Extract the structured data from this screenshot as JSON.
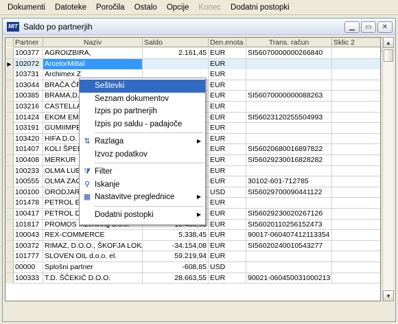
{
  "menubar": {
    "items": [
      "Dokumenti",
      "Datoteke",
      "Poročila",
      "Ostalo",
      "Opcije",
      "Konec",
      "Dodatni postopki"
    ]
  },
  "window": {
    "title": "Saldo po partnerjih",
    "logo": "MIT"
  },
  "grid": {
    "columns": [
      "Partner",
      "Naziv",
      "Saldo",
      "Den.enota",
      "Trans. račun",
      "Sklic 2"
    ],
    "rows": [
      {
        "partner": "100377",
        "naziv": "AGROIZBIRA,",
        "saldo": "2.161,45",
        "den": "EUR",
        "trans": "SI56070000000266840"
      },
      {
        "partner": "102072",
        "naziv": "ArcelorMittal",
        "saldo": "",
        "den": "EUR",
        "trans": ""
      },
      {
        "partner": "103731",
        "naziv": "Archimex Z",
        "saldo": "",
        "den": "EUR",
        "trans": ""
      },
      {
        "partner": "103044",
        "naziv": "BRAČA ČR",
        "saldo": "",
        "den": "EUR",
        "trans": ""
      },
      {
        "partner": "100385",
        "naziv": "BRAMA,D.",
        "saldo": "",
        "den": "EUR",
        "trans": "SI56070000000088263"
      },
      {
        "partner": "103216",
        "naziv": "CASTELLA",
        "saldo": "",
        "den": "EUR",
        "trans": ""
      },
      {
        "partner": "101424",
        "naziv": "EKOM EM",
        "saldo": "",
        "den": "EUR",
        "trans": "SI56023120255504993"
      },
      {
        "partner": "103191",
        "naziv": "GUMIIMPE",
        "saldo": "",
        "den": "EUR",
        "trans": ""
      },
      {
        "partner": "103420",
        "naziv": "HIFA D.O.",
        "saldo": "",
        "den": "EUR",
        "trans": ""
      },
      {
        "partner": "101407",
        "naziv": "KOLI ŠPED",
        "saldo": "",
        "den": "EUR",
        "trans": "SI56020680016897822"
      },
      {
        "partner": "100408",
        "naziv": "MERKUR",
        "saldo": "",
        "den": "EUR",
        "trans": "SI56029230016828282"
      },
      {
        "partner": "100233",
        "naziv": "OLMA LUB",
        "saldo": "",
        "den": "EUR",
        "trans": ""
      },
      {
        "partner": "100555",
        "naziv": "OLMA ZAC",
        "saldo": "",
        "den": "EUR",
        "trans": "30102-601-712785"
      },
      {
        "partner": "100100",
        "naziv": "ORODJAR",
        "saldo": "",
        "den": "USD",
        "trans": "SI56029700090441122"
      },
      {
        "partner": "101478",
        "naziv": "PETROL E",
        "saldo": "",
        "den": "EUR",
        "trans": ""
      },
      {
        "partner": "100417",
        "naziv": "PETROL D.D.,LJUBLJANA",
        "saldo": "382.106,24",
        "den": "EUR",
        "trans": "SI56029230020267126"
      },
      {
        "partner": "101817",
        "naziv": "PROMOS Inženiring d.o.o.",
        "saldo": "15.458,93",
        "den": "EUR",
        "trans": "SI56020110256152473"
      },
      {
        "partner": "100043",
        "naziv": "REX-COMMERCE",
        "saldo": "5.338,45",
        "den": "EUR",
        "trans": "90017-060407412113354"
      },
      {
        "partner": "100372",
        "naziv": "RIMAZ, D.O.O., ŠKOFJA LOKA",
        "saldo": "-34.154,08",
        "den": "EUR",
        "trans": "SI56020240010543277"
      },
      {
        "partner": "101777",
        "naziv": "SLOVEN OIL d.o.o. el.",
        "saldo": "59.219,94",
        "den": "EUR",
        "trans": ""
      },
      {
        "partner": "00000",
        "naziv": "Splošni partner",
        "saldo": "-608,85",
        "den": "USD",
        "trans": ""
      },
      {
        "partner": "100333",
        "naziv": "T.D. ŠČEKIĆ D.O.O.",
        "saldo": "28.663,55",
        "den": "EUR",
        "trans": "90021-060450031000213"
      }
    ]
  },
  "context_menu": {
    "items": [
      {
        "label": "Seštevki",
        "highlight": true
      },
      {
        "label": "Seznam dokumentov"
      },
      {
        "label": "Izpis po partnerjih"
      },
      {
        "label": "Izpis po saldu - padajoče"
      },
      {
        "sep": true
      },
      {
        "label": "Razlaga",
        "icon": "sort-icon",
        "sub": true
      },
      {
        "label": "Izvoz podatkov"
      },
      {
        "sep": true
      },
      {
        "label": "Filter",
        "icon": "filter-icon"
      },
      {
        "label": "Iskanje",
        "icon": "search-icon"
      },
      {
        "label": "Nastavitve preglednice",
        "icon": "grid-settings-icon",
        "sub": true
      },
      {
        "sep": true
      },
      {
        "label": "Dodatni postopki",
        "sub": true
      }
    ]
  }
}
